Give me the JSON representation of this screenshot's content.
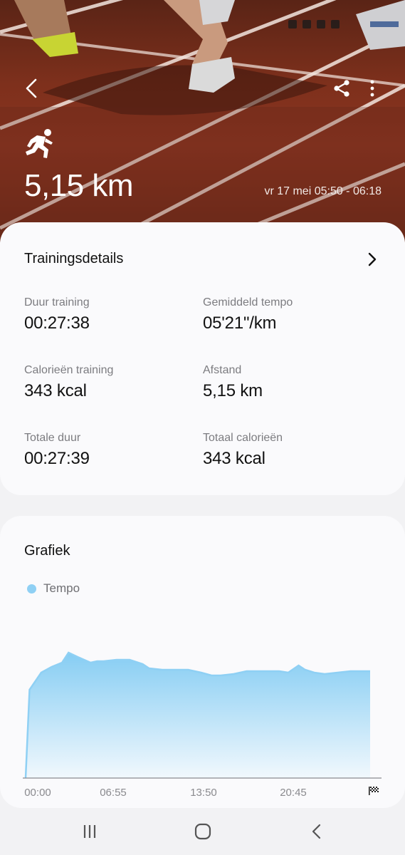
{
  "hero": {
    "distance": "5,15 km",
    "date_range": "vr 17 mei 05:50 - 06:18",
    "icons": {
      "back": "back-arrow-icon",
      "share": "share-icon",
      "more": "more-vertical-icon",
      "activity": "running-icon"
    }
  },
  "details": {
    "title": "Trainingsdetails",
    "stats": [
      {
        "label": "Duur training",
        "value": "00:27:38"
      },
      {
        "label": "Gemiddeld tempo",
        "value": "05'21\"/km"
      },
      {
        "label": "Calorieën training",
        "value": "343 kcal"
      },
      {
        "label": "Afstand",
        "value": "5,15 km"
      },
      {
        "label": "Totale duur",
        "value": "00:27:39"
      },
      {
        "label": "Totaal calorieën",
        "value": "343 kcal"
      }
    ]
  },
  "graph": {
    "title": "Grafiek",
    "legend": "Tempo"
  },
  "chart_data": {
    "type": "area",
    "series": [
      {
        "name": "Tempo",
        "color": "#8fd0f4",
        "x": [
          0,
          0.3,
          1.2,
          2.0,
          2.8,
          3.3,
          4.0,
          5.0,
          5.5,
          6.0,
          7.0,
          8.0,
          9.0,
          9.5,
          10.5,
          11.5,
          12.5,
          13.5,
          14.3,
          15.0,
          16.0,
          17.0,
          18.0,
          18.8,
          19.5,
          20.2,
          21.0,
          21.5,
          22.2,
          23.0,
          24.0,
          25.0,
          26.0,
          26.5
        ],
        "values": [
          0,
          62,
          74,
          78,
          81,
          88,
          85,
          81,
          82,
          82,
          83,
          83,
          80,
          77,
          76,
          76,
          76,
          74,
          72,
          72,
          73,
          75,
          75,
          75,
          75,
          74,
          79,
          76,
          74,
          73,
          74,
          75,
          75,
          75
        ]
      }
    ],
    "x_ticks": [
      "00:00",
      "06:55",
      "13:50",
      "20:45"
    ],
    "x_end_icon": "finish-flag-icon",
    "ylim": [
      0,
      100
    ],
    "grid": false
  },
  "navbar": {
    "recents": "recents-icon",
    "home": "home-icon",
    "back": "nav-back-icon"
  }
}
